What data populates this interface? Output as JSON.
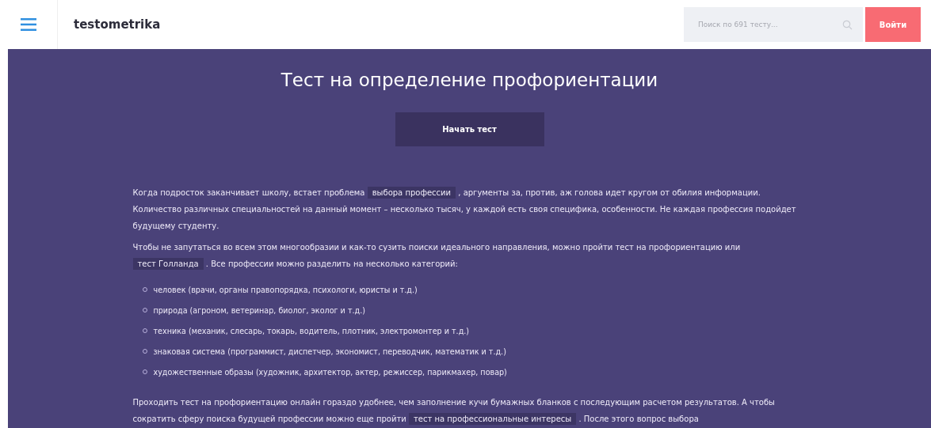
{
  "header": {
    "logo": "testometrika",
    "search": {
      "placeholder": "Поиск по 691 тесту..."
    },
    "login_button": "Войти"
  },
  "hero": {
    "title": "Тест на определение профориентации",
    "start_button": "Начать тест"
  },
  "content": [
    {
      "kind": "paragraph",
      "parts": [
        {
          "kind": "text",
          "text": "Когда подросток заканчивает школу, встает проблема "
        },
        {
          "kind": "link",
          "text": "выбора профессии"
        },
        {
          "kind": "text",
          "text": " , аргументы за, против, аж голова идет кругом от обилия информации. Количество различных специальностей на данный момент – несколько тысяч, у каждой есть своя специфика, особенности. Не каждая профессия подойдет будущему студенту."
        }
      ]
    },
    {
      "kind": "paragraph",
      "parts": [
        {
          "kind": "text",
          "text": "Чтобы не запутаться во всем этом многообразии и как-то сузить поиски идеального направления, можно пройти тест на профориентацию или "
        },
        {
          "kind": "link",
          "text": "тест Голланда"
        },
        {
          "kind": "text",
          "text": " . Все профессии можно разделить на несколько категорий:"
        }
      ]
    },
    {
      "kind": "list",
      "items": [
        "человек (врачи, органы правопорядка, психологи, юристы и т.д.)",
        "природа (агроном, ветеринар, биолог, эколог и т.д.)",
        "техника (механик, слесарь, токарь, водитель, плотник, электромонтер и т.д.)",
        "знаковая система (программист, диспетчер, экономист, переводчик, математик и т.д.)",
        "художественные образы (художник, архитектор, актер, режиссер, парикмахер, повар)"
      ]
    },
    {
      "kind": "paragraph",
      "parts": [
        {
          "kind": "text",
          "text": "Проходить тест на профориентацию онлайн гораздо удобнее, чем заполнение кучи бумажных бланков с последующим расчетом результатов. А чтобы сократить сферу поиска будущей профессии можно еще пройти "
        },
        {
          "kind": "link",
          "text": "тест на профессиональные интересы"
        },
        {
          "kind": "text",
          "text": " . После этого вопрос выбора"
        }
      ]
    }
  ]
}
